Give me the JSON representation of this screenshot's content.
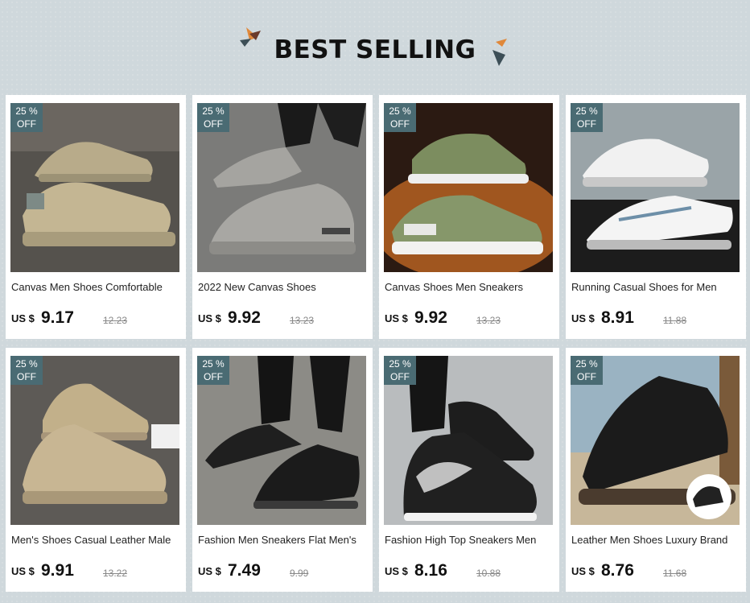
{
  "header": {
    "title": "BEST SELLING"
  },
  "colors": {
    "badge": "#4a6b73",
    "accent_orange": "#e0883a",
    "accent_dark": "#3d4f57"
  },
  "products": [
    {
      "discount_pct": "25 %",
      "discount_off": "OFF",
      "name": "Canvas Men Shoes Comfortable",
      "currency": "US $",
      "price": "9.17",
      "old_price": "12.23",
      "image": "khaki-canvas-sneakers"
    },
    {
      "discount_pct": "25 %",
      "discount_off": "OFF",
      "name": "2022 New Canvas Shoes",
      "currency": "US $",
      "price": "9.92",
      "old_price": "13.23",
      "image": "grey-canvas-sneaker-on-foot"
    },
    {
      "discount_pct": "25 %",
      "discount_off": "OFF",
      "name": "Canvas Shoes Men Sneakers",
      "currency": "US $",
      "price": "9.92",
      "old_price": "13.23",
      "image": "green-sneakers-on-wood"
    },
    {
      "discount_pct": "25 %",
      "discount_off": "OFF",
      "name": "Running Casual Shoes for Men",
      "currency": "US $",
      "price": "8.91",
      "old_price": "11.88",
      "image": "white-knit-running-shoes"
    },
    {
      "discount_pct": "25 %",
      "discount_off": "OFF",
      "name": "Men's Shoes Casual Leather Male",
      "currency": "US $",
      "price": "9.91",
      "old_price": "13.22",
      "image": "tan-leather-boots"
    },
    {
      "discount_pct": "25 %",
      "discount_off": "OFF",
      "name": "Fashion Men Sneakers Flat Men's",
      "currency": "US $",
      "price": "7.49",
      "old_price": "9.99",
      "image": "black-canvas-sneakers-on-foot"
    },
    {
      "discount_pct": "25 %",
      "discount_off": "OFF",
      "name": "Fashion High Top Sneakers Men",
      "currency": "US $",
      "price": "8.16",
      "old_price": "10.88",
      "image": "black-white-high-tops"
    },
    {
      "discount_pct": "25 %",
      "discount_off": "OFF",
      "name": "Leather Men Shoes Luxury Brand",
      "currency": "US $",
      "price": "8.76",
      "old_price": "11.68",
      "image": "black-leather-hiking-shoe"
    }
  ]
}
